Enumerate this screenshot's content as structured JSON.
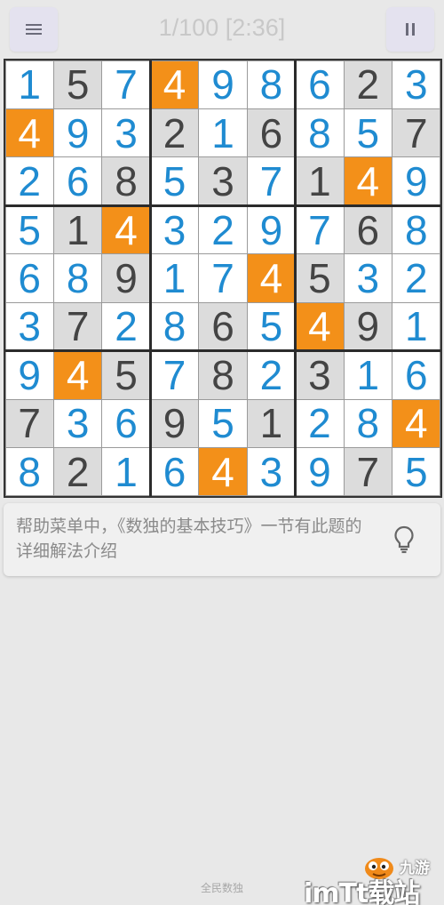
{
  "header": {
    "menu_icon": "menu-list-icon",
    "pause_icon": "pause-icon",
    "progress_timer": "1/100 [2:36]"
  },
  "puzzle": {
    "highlight_digit": 4,
    "colors": {
      "given_text": "#444444",
      "given_bg": "#dcdcdc",
      "entered_text": "#1f8bd1",
      "entered_bg": "#ffffff",
      "highlight_bg": "#f39019"
    },
    "rows": [
      [
        1,
        5,
        7,
        4,
        9,
        8,
        6,
        2,
        3
      ],
      [
        4,
        9,
        3,
        2,
        1,
        6,
        8,
        5,
        7
      ],
      [
        2,
        6,
        8,
        5,
        3,
        7,
        1,
        4,
        9
      ],
      [
        5,
        1,
        4,
        3,
        2,
        9,
        7,
        6,
        8
      ],
      [
        6,
        8,
        9,
        1,
        7,
        4,
        5,
        3,
        2
      ],
      [
        3,
        7,
        2,
        8,
        6,
        5,
        4,
        9,
        1
      ],
      [
        9,
        4,
        5,
        7,
        8,
        2,
        3,
        1,
        6
      ],
      [
        7,
        3,
        6,
        9,
        5,
        1,
        2,
        8,
        4
      ],
      [
        8,
        2,
        1,
        6,
        4,
        3,
        9,
        7,
        5
      ]
    ],
    "given": [
      [
        0,
        1,
        0,
        0,
        0,
        0,
        0,
        1,
        0
      ],
      [
        0,
        0,
        0,
        1,
        0,
        1,
        0,
        0,
        1
      ],
      [
        0,
        0,
        1,
        0,
        1,
        0,
        1,
        0,
        0
      ],
      [
        0,
        1,
        0,
        0,
        0,
        0,
        0,
        1,
        0
      ],
      [
        0,
        0,
        1,
        0,
        0,
        0,
        1,
        0,
        0
      ],
      [
        0,
        1,
        0,
        0,
        1,
        0,
        0,
        1,
        0
      ],
      [
        0,
        0,
        1,
        0,
        1,
        0,
        1,
        0,
        0
      ],
      [
        1,
        0,
        0,
        1,
        0,
        1,
        0,
        0,
        0
      ],
      [
        0,
        1,
        0,
        0,
        0,
        0,
        0,
        1,
        0
      ]
    ]
  },
  "hint": {
    "text": "帮助菜单中，《数独的基本技巧》一节有此题的详细解法介绍",
    "icon": "lightbulb-icon"
  },
  "footer": {
    "app_name": "全民数独"
  },
  "watermark": {
    "logo_text": "九游",
    "site_text": "imTt载站"
  }
}
